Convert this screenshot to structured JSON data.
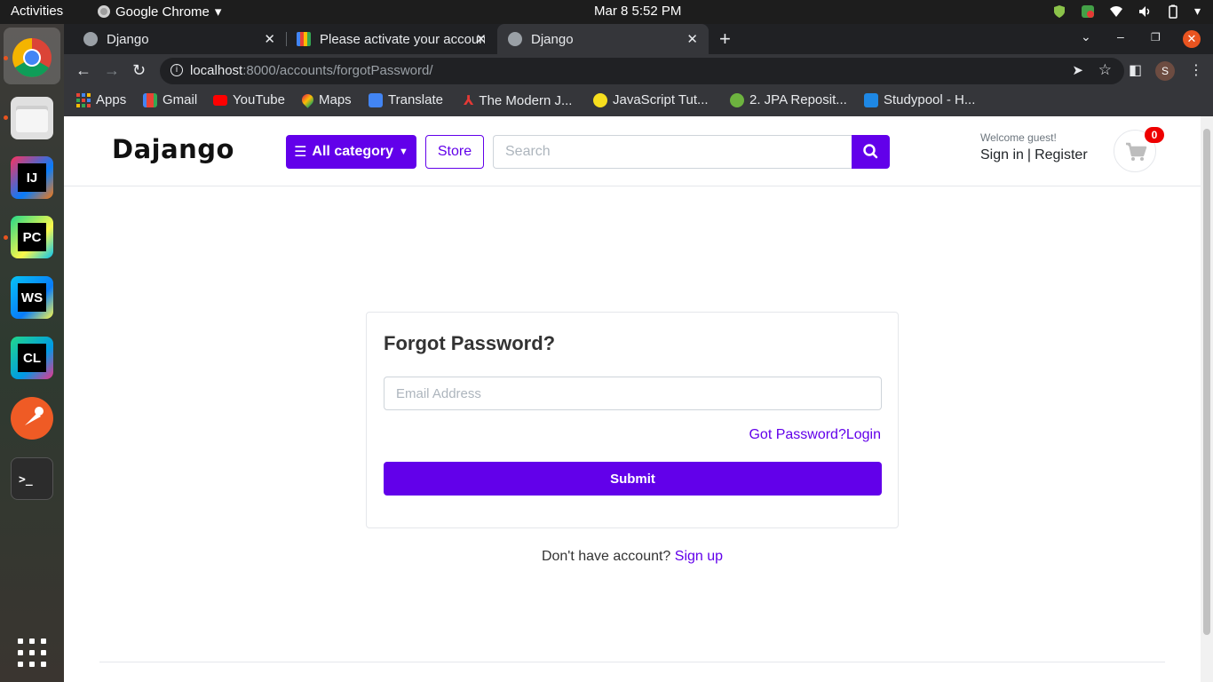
{
  "system": {
    "activities": "Activities",
    "app_name": "Google Chrome",
    "clock": "Mar 8   5:52 PM"
  },
  "dock": {
    "items": [
      "chrome",
      "files",
      "intellij",
      "pycharm",
      "webstorm",
      "clion",
      "postman",
      "terminal",
      "apps-grid"
    ],
    "labels": {
      "intellij": "IJ",
      "pycharm": "PC",
      "webstorm": "WS",
      "clion": "CL",
      "terminal": ">_"
    }
  },
  "browser": {
    "tabs": [
      {
        "title": "Django",
        "active": false
      },
      {
        "title": "Please activate your account",
        "active": false
      },
      {
        "title": "Django",
        "active": true
      }
    ],
    "url_host": "localhost",
    "url_path": ":8000/accounts/forgotPassword/",
    "avatar_letter": "S",
    "bookmarks": [
      {
        "label": "Apps",
        "color": "#ea4335"
      },
      {
        "label": "Gmail",
        "color": "#ea4335"
      },
      {
        "label": "YouTube",
        "color": "#ff0000"
      },
      {
        "label": "Maps",
        "color": "#34a853"
      },
      {
        "label": "Translate",
        "color": "#4285f4"
      },
      {
        "label": "The Modern J...",
        "color": "#e53935"
      },
      {
        "label": "JavaScript Tut...",
        "color": "#f7df1e"
      },
      {
        "label": "2. JPA Reposit...",
        "color": "#6db33f"
      },
      {
        "label": "Studypool - H...",
        "color": "#1e88e5"
      }
    ]
  },
  "site": {
    "brand": "Dajango",
    "category_button": "All category",
    "store_button": "Store",
    "search_placeholder": "Search",
    "welcome": "Welcome guest!",
    "sign_in": "Sign in",
    "register": "Register",
    "cart_count": "0",
    "accent_color": "#6200ea"
  },
  "form": {
    "title": "Forgot Password?",
    "email_placeholder": "Email Address",
    "got_password_link": "Got Password?Login",
    "submit_label": "Submit",
    "no_account_text": "Don't have account?",
    "signup_link": "Sign up"
  }
}
